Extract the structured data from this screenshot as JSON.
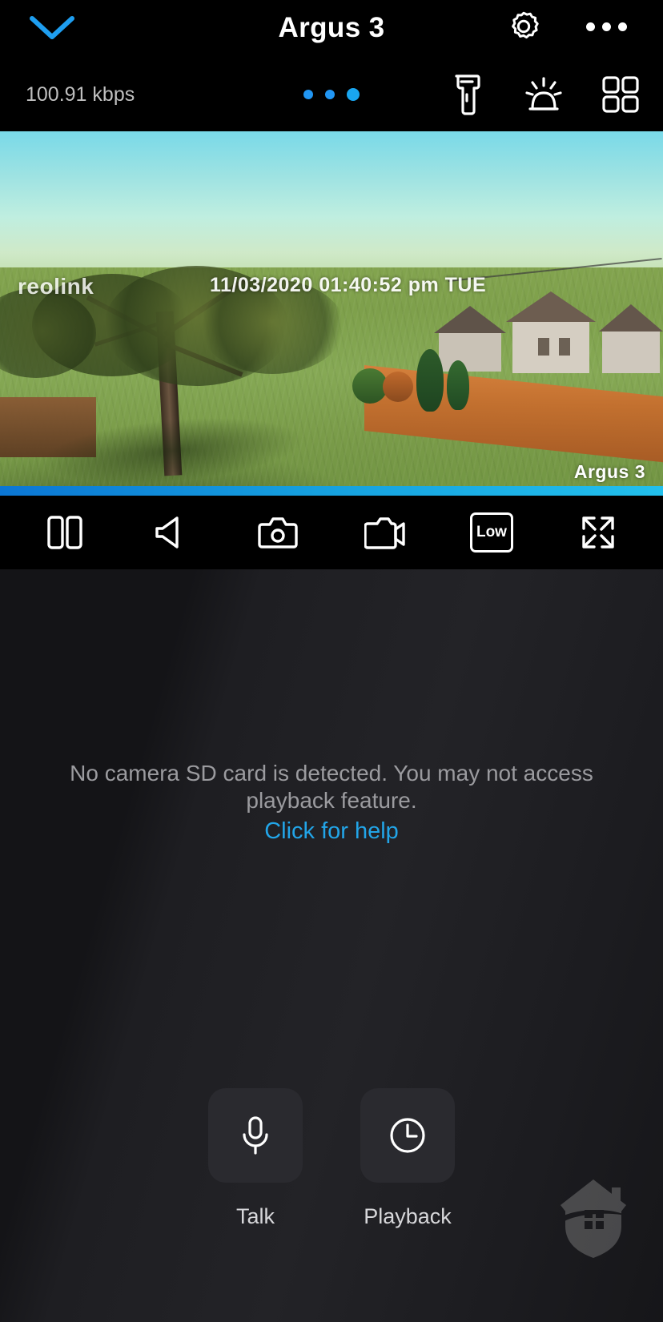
{
  "nav": {
    "back_icon": "chevron-down-icon",
    "title": "Argus 3",
    "settings_icon": "gear-icon",
    "more_icon": "more-horizontal-icon"
  },
  "status": {
    "bitrate": "100.91 kbps",
    "page_dots": 3,
    "active_dot_index": 2,
    "icons": [
      {
        "name": "flashlight-icon",
        "label": "Flashlight"
      },
      {
        "name": "siren-icon",
        "label": "Siren"
      },
      {
        "name": "grid-view-icon",
        "label": "Grid view"
      }
    ]
  },
  "video": {
    "brand_watermark": "reolink",
    "timestamp": "11/03/2020 01:40:52 pm TUE",
    "camera_label": "Argus 3",
    "accent_color": "#19a6f0"
  },
  "controls": [
    {
      "name": "split-view-button",
      "label": "Split view",
      "icon": "split-screen-icon"
    },
    {
      "name": "mute-button",
      "label": "Mute",
      "icon": "speaker-icon"
    },
    {
      "name": "snapshot-button",
      "label": "Snapshot",
      "icon": "camera-icon"
    },
    {
      "name": "record-button",
      "label": "Record",
      "icon": "video-camera-icon"
    },
    {
      "name": "quality-button",
      "label": "Low",
      "icon": "quality-badge-icon"
    },
    {
      "name": "fullscreen-button",
      "label": "Fullscreen",
      "icon": "expand-icon"
    }
  ],
  "quality": {
    "value": "Low"
  },
  "panel": {
    "empty_message": "No camera SD card is detected. You may not access playback feature.",
    "help_link": "Click for help",
    "help_color": "#22a5e8",
    "actions": [
      {
        "name": "talk-button",
        "label": "Talk",
        "icon": "microphone-icon"
      },
      {
        "name": "playback-button",
        "label": "Playback",
        "icon": "clock-icon"
      }
    ],
    "watermark_icon": "house-shield-icon"
  }
}
